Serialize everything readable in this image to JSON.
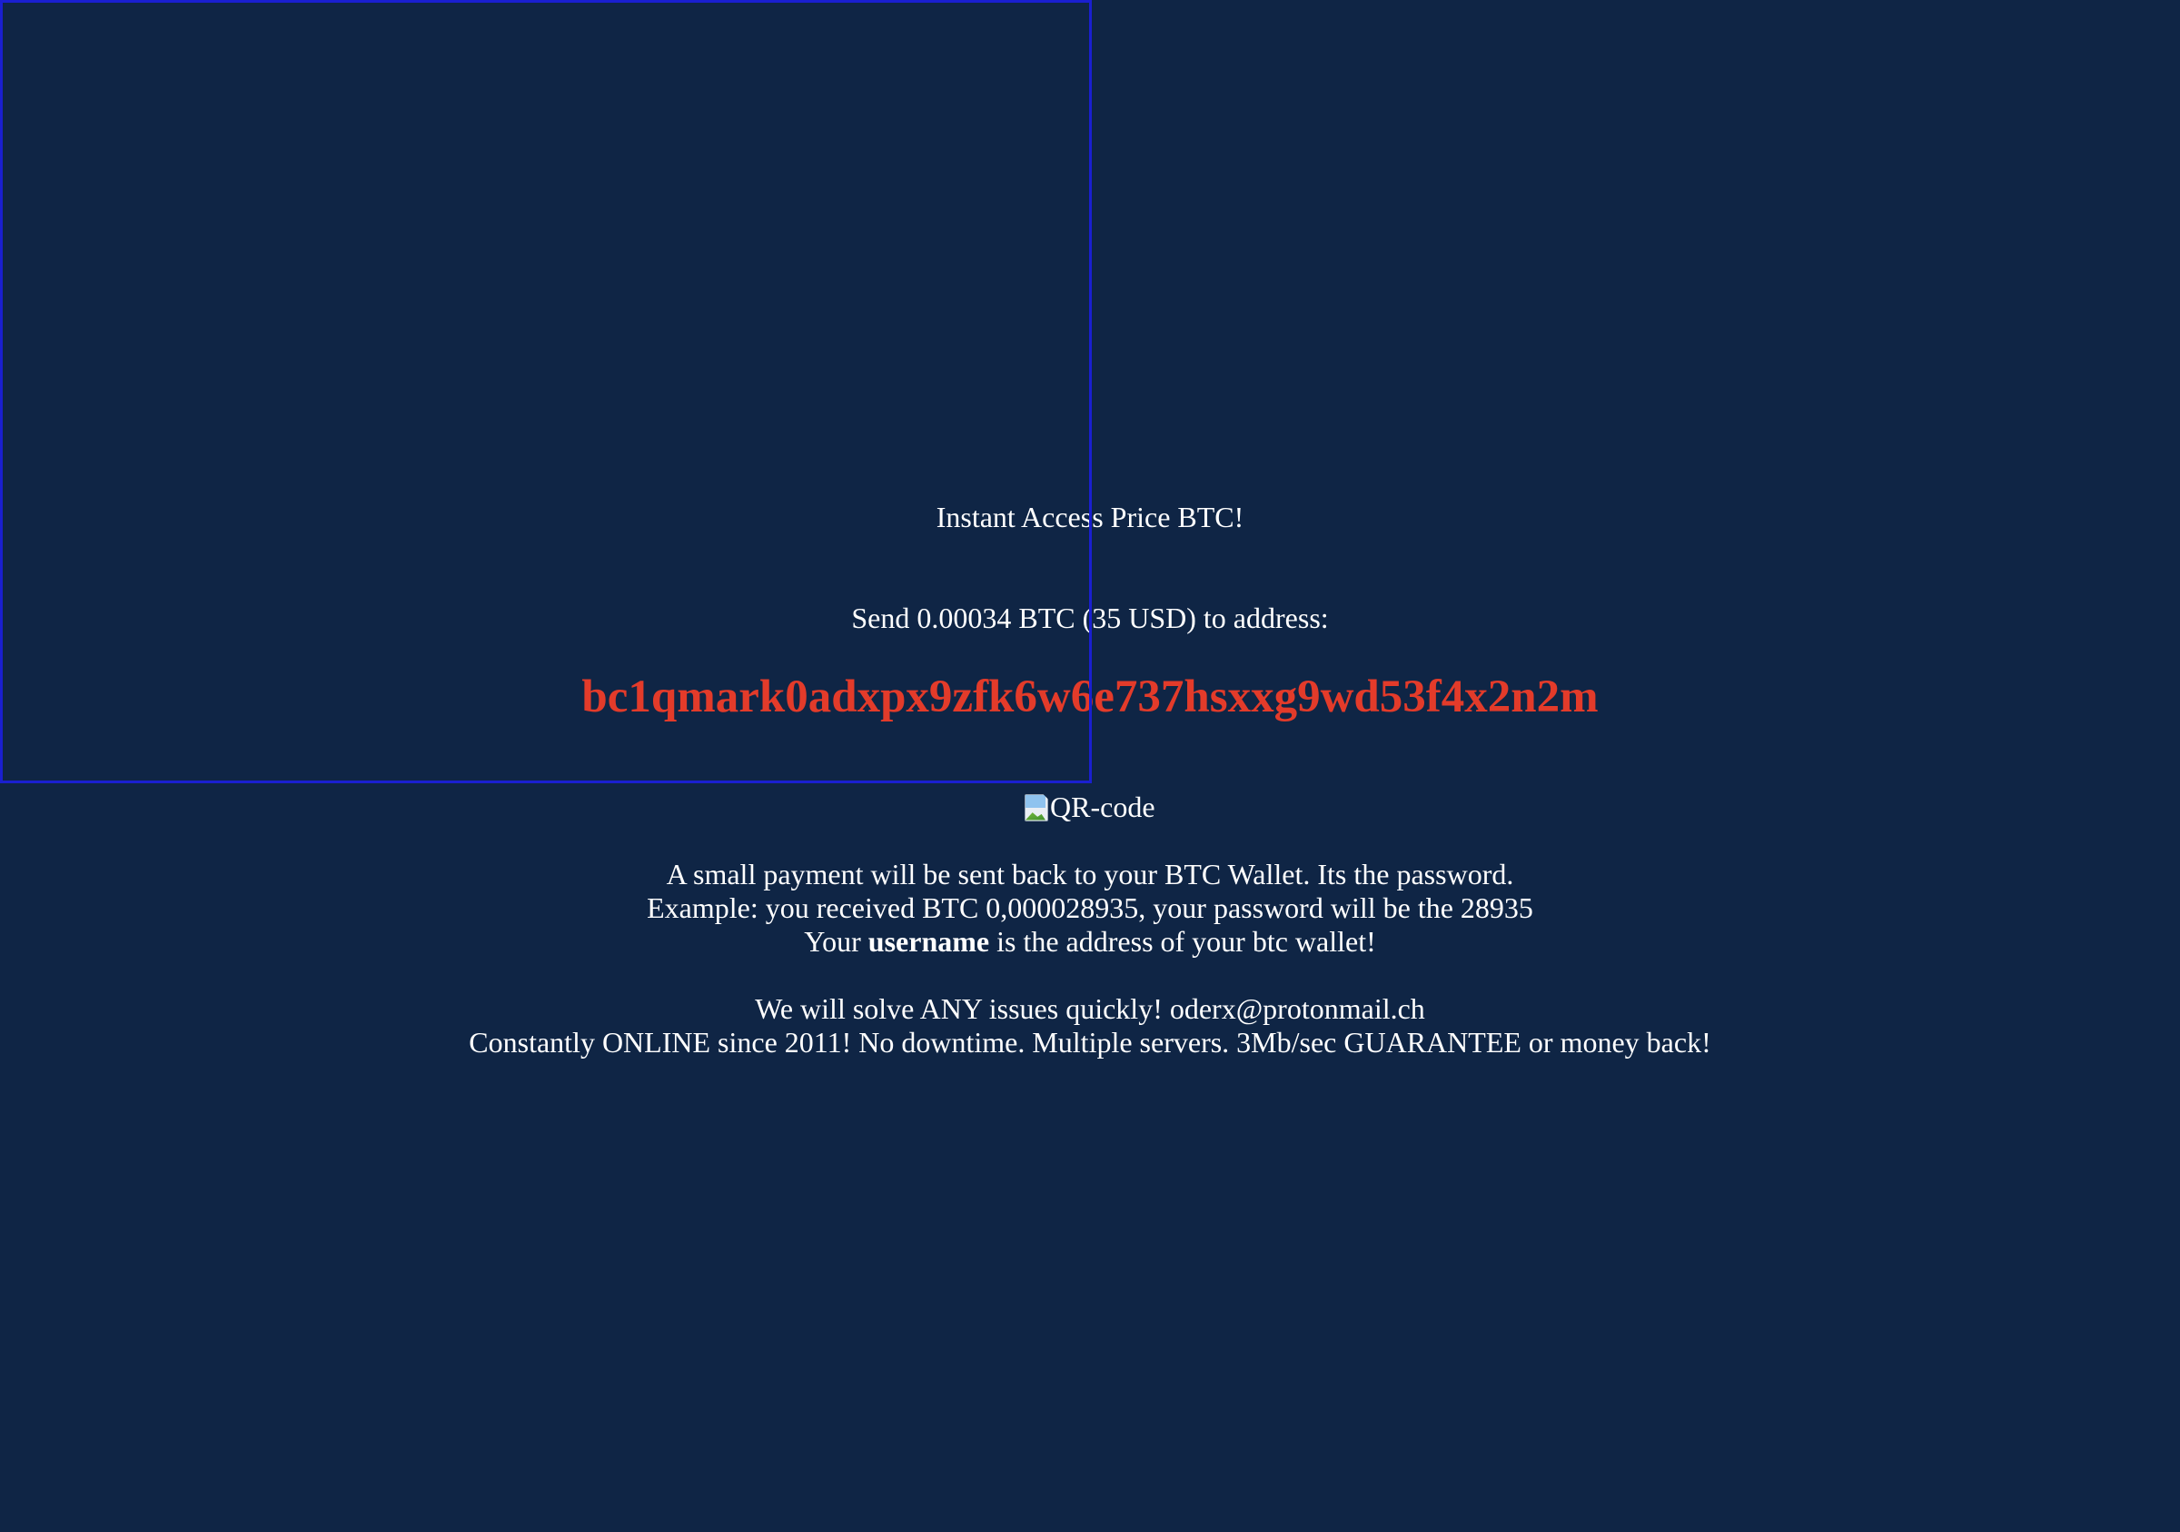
{
  "header": {
    "title": "Instant Access Price BTC!"
  },
  "payment": {
    "send_instruction": "Send 0.00034 BTC (35 USD) to address:",
    "address": "bc1qmark0adxpx9zfk6w6e737hsxxg9wd53f4x2n2m",
    "address_color": "#e33b2a"
  },
  "qr": {
    "alt_text": "QR-code",
    "icon": "broken-image-icon"
  },
  "info": {
    "line1": "A small payment will be sent back to your BTC Wallet. Its the password.",
    "line2": "Example: you received BTC 0,000028935, your password will be the 28935",
    "line3_prefix": "Your",
    "line3_bold": "username",
    "line3_suffix": "is the address of your btc wallet!"
  },
  "support": {
    "line1": "We will solve ANY issues quickly! oderx@protonmail.ch",
    "line2": "Constantly ONLINE since 2011! No downtime. Multiple servers. 3Mb/sec GUARANTEE or money back!"
  },
  "colors": {
    "background": "#0f2545",
    "text": "#ffffff",
    "frame_border": "#1a1fd0"
  }
}
